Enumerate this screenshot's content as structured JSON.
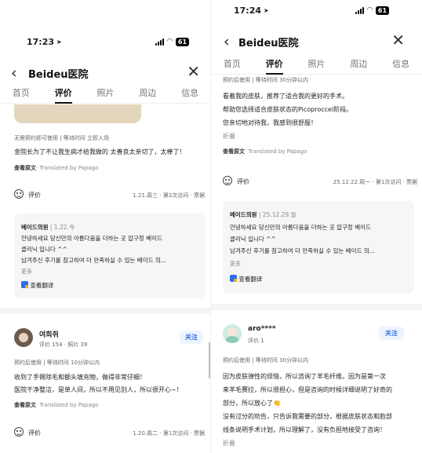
{
  "left": {
    "status": {
      "time": "17:23"
    },
    "header": {
      "title": "Beideu医院"
    },
    "tabs": [
      "首页",
      "评价",
      "照片",
      "周边",
      "信息"
    ],
    "review1": {
      "meta": "无需预约即可使用 | 等待时间 立即入场",
      "text": "金院长为了不让我生病才给我做的 太善良太亲切了，太棒了！",
      "view_original": "查看原文",
      "translated": "· Translated by Papago",
      "rate_label": "评价",
      "visit_info": "1.21.周三 · 第2次访问 · 票据"
    },
    "reply1": {
      "hospital": "베이드의원",
      "date": "1.22.今",
      "lines": [
        "안녕하세요 당신만의 아름다움을 더하는 곳 압구정 베이드",
        "클리닉 입니다 ^^",
        "남겨주신 후기를 참고하여 더 만족하실 수 있는 베이드 의..."
      ],
      "more": "更多",
      "translate": "查看翻译"
    },
    "review2": {
      "name": "여희쥐",
      "stats": "评价 154 · 照片 39",
      "follow": "关注",
      "meta": "预约后使用 | 等待时间 10分钟以内",
      "lines": [
        "收到了手臂除毛和额头填充物，做得非常仔细！",
        "医院干净整洁，是单人间，所以不用见别人，所以很开心~！"
      ],
      "view_original": "查看原文",
      "translated": "· Translated by Papago",
      "rate_label": "评价",
      "visit_info": "1.20.周二 · 第1次访问 · 票据"
    }
  },
  "right": {
    "status": {
      "time": "17:24"
    },
    "header": {
      "title": "Beideu医院"
    },
    "tabs": [
      "首页",
      "评价",
      "照片",
      "周边",
      "信息"
    ],
    "review1": {
      "meta": "预约后使用 | 等待时间 30分钟以内",
      "lines": [
        "看着我的皮肤，推荐了适合我的更好的手术。",
        "帮助您选择适合皮肤状态的Picoproccel阶段。",
        "您亲切地对待我，我感到很舒服！"
      ],
      "fold": "折叠",
      "view_original": "查看原文",
      "translated": "· Translated by Papago",
      "rate_label": "评价",
      "visit_info": "25.12.22.周一 · 第1次访问 · 票据"
    },
    "reply1": {
      "hospital": "베이드의원",
      "date": "25.12.29.월",
      "lines": [
        "안녕하세요 당신만의 아름다움을 더하는 곳 압구정 베이드",
        "클리닉 입니다 ^^",
        "남겨주신 후기를 참고하여 더 만족하실 수 있는 베이드 의..."
      ],
      "more": "更多",
      "translate": "查看翻译"
    },
    "review2": {
      "name": "aro****",
      "stats": "评价 1",
      "follow": "关注",
      "meta": "预约后使用 | 等待时间 30分钟以内",
      "lines": [
        "因为皮肤弹性的烦恼，所以咨询了羊毛纤维。因为是第一次",
        "来羊毛赛拉，所以很担心，但是咨询的时候详细说明了好奇的",
        "部分，所以放心了👏",
        "没有过分的劝告，只告诉我需要的部分，根据皮肤状态和脸部",
        "线条说明手术计划，所以理解了，没有负担地接受了咨询！"
      ],
      "fold": "折叠"
    }
  }
}
